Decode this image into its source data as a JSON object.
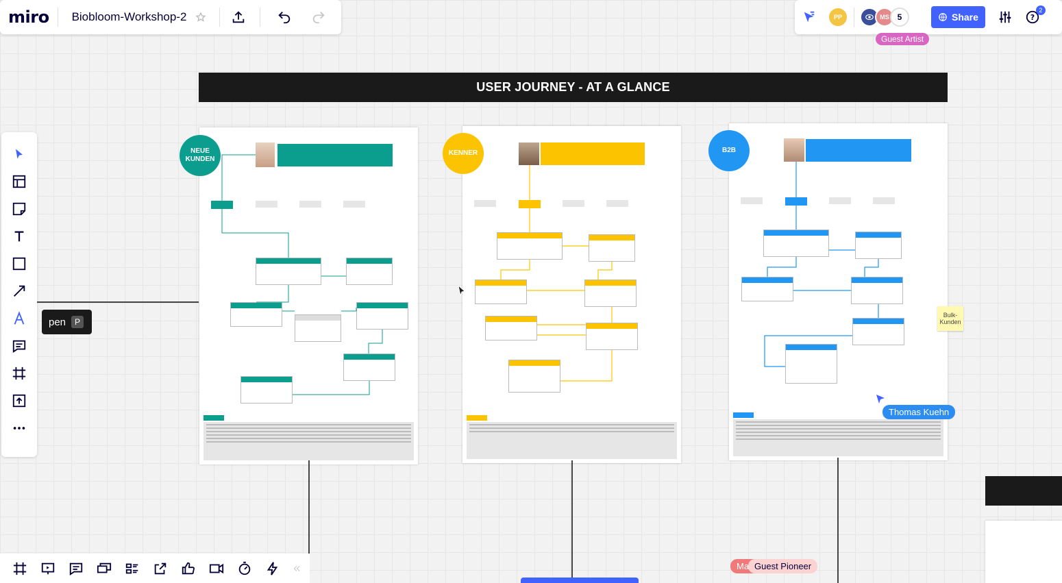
{
  "app": {
    "logo": "miro",
    "board_name": "Biobloom-Workshop-2"
  },
  "header": {
    "collaborator_count": "5",
    "avatar_pp": "PP",
    "avatar_ms": "MS",
    "share_label": "Share",
    "help_badge": "2"
  },
  "cursors": {
    "guest_artist": "Guest Artist",
    "thomas": "Thomas Kuehn",
    "guest_pioneer": "Guest Pioneer",
    "ma_prefix": "Ma"
  },
  "tooltip": {
    "label": "pen",
    "shortcut": "P"
  },
  "board": {
    "banner_title": "USER JOURNEY - AT A GLANCE",
    "personas": [
      {
        "badge": "NEUE KUNDEN",
        "color": "#0b9e8e"
      },
      {
        "badge": "KENNER",
        "color": "#fcc400"
      },
      {
        "badge": "B2B",
        "color": "#2196f3"
      }
    ],
    "sticky_note": "Bulk-Kunden"
  },
  "colors": {
    "accent": "#4262ff",
    "teal": "#0b9e8e",
    "yellow": "#fcc400",
    "blue": "#2196f3"
  }
}
